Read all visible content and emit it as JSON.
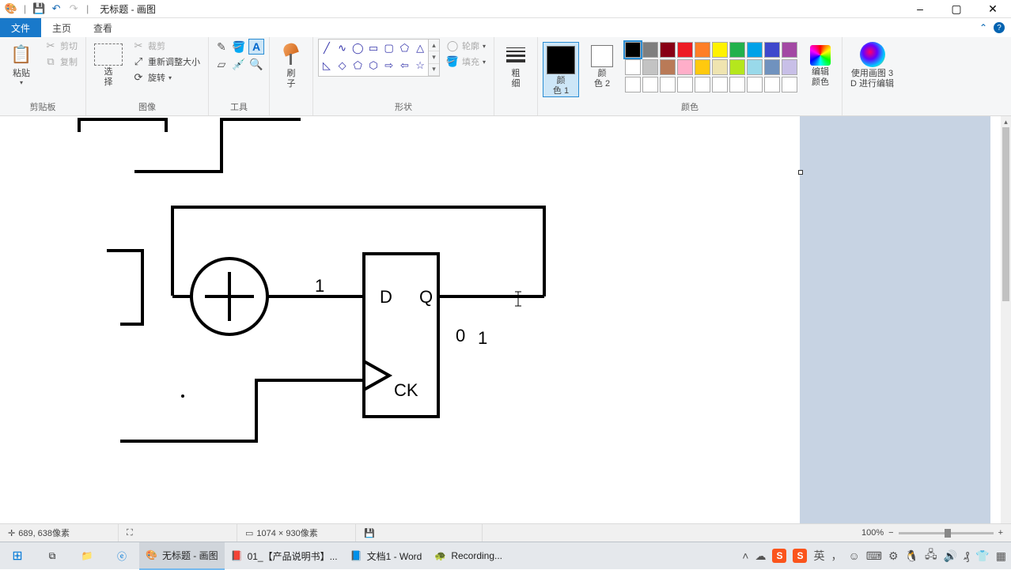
{
  "window": {
    "title": "无标题 - 画图",
    "controls": {
      "min": "–",
      "max": "▢",
      "close": "✕"
    }
  },
  "tabs": {
    "file": "文件",
    "home": "主页",
    "view": "查看",
    "collapse": "⌃",
    "help": "?"
  },
  "ribbon": {
    "clipboard": {
      "paste": "粘贴",
      "cut": "剪切",
      "copy": "复制",
      "group": "剪贴板"
    },
    "image": {
      "select": "选\n择",
      "crop": "裁剪",
      "resize": "重新调整大小",
      "rotate": "旋转",
      "group": "图像"
    },
    "tools": {
      "group": "工具"
    },
    "brush": {
      "label": "刷\n子"
    },
    "shapes": {
      "outline": "轮廓",
      "fill": "填充",
      "group": "形状"
    },
    "size": {
      "label": "粗\n细"
    },
    "colors": {
      "color1": "颜\n色 1",
      "color2": "颜\n色 2",
      "edit": "编辑\n颜色",
      "group": "颜色",
      "palette_row1": [
        "#000000",
        "#7f7f7f",
        "#880015",
        "#ed1c24",
        "#ff7f27",
        "#fff200",
        "#22b14c",
        "#00a2e8",
        "#3f48cc",
        "#a349a4"
      ],
      "palette_row2": [
        "#ffffff",
        "#c3c3c3",
        "#b97a57",
        "#ffaec9",
        "#ffc90e",
        "#efe4b0",
        "#b5e61d",
        "#99d9ea",
        "#7092be",
        "#c8bfe7"
      ]
    },
    "paint3d": {
      "label": "使用画图 3\nD 进行编辑"
    }
  },
  "canvas": {
    "labels": {
      "D": "D",
      "Q": "Q",
      "CK": "CK",
      "one": "1",
      "zero": "0",
      "one2": "1"
    }
  },
  "status": {
    "pos_icon": "✛",
    "pos": "689, 638像素",
    "sel_icon": "⛶",
    "sel": "",
    "size_icon": "▭",
    "size": "1074 × 930像素",
    "disk": "",
    "zoom_pct": "100%",
    "zoom_minus": "−",
    "zoom_plus": "+"
  },
  "taskbar": {
    "apps": [
      {
        "name": "paint",
        "label": "无标题 - 画图",
        "icon": "🎨",
        "active": true
      },
      {
        "name": "pdf",
        "label": "01_【产品说明书】...",
        "icon": "📕",
        "active": false
      },
      {
        "name": "word",
        "label": "文档1 - Word",
        "icon": "📘",
        "active": false
      },
      {
        "name": "rec",
        "label": "Recording...",
        "icon": "🐢",
        "active": false
      }
    ],
    "ime_label": "英"
  }
}
